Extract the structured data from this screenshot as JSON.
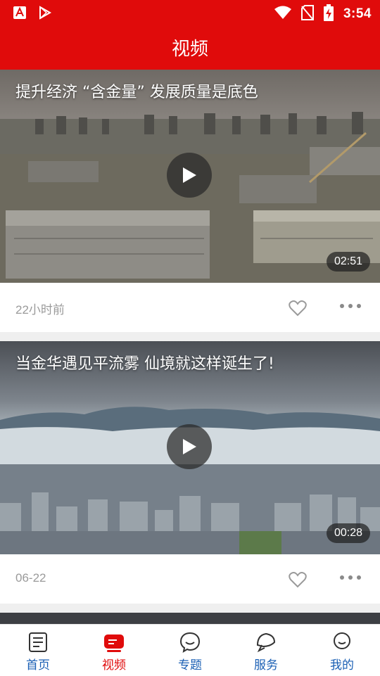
{
  "status_bar": {
    "time": "3:54"
  },
  "app_bar": {
    "title": "视频"
  },
  "videos": [
    {
      "title": "提升经济 “含金量” 发展质量是底色",
      "duration": "02:51",
      "time_ago": "22小时前"
    },
    {
      "title": "当金华遇见平流雾 仙境就这样诞生了!",
      "duration": "00:28",
      "time_ago": "06-22"
    }
  ],
  "tabs": [
    {
      "label": "首页",
      "icon": "news-icon",
      "active": false
    },
    {
      "label": "视频",
      "icon": "video-icon",
      "active": true
    },
    {
      "label": "专题",
      "icon": "chat-bubble-icon",
      "active": false
    },
    {
      "label": "服务",
      "icon": "service-icon",
      "active": false
    },
    {
      "label": "我的",
      "icon": "profile-icon",
      "active": false
    }
  ],
  "colors": {
    "brand_red": "#e00b0b",
    "tab_blue": "#1a5fb4"
  }
}
